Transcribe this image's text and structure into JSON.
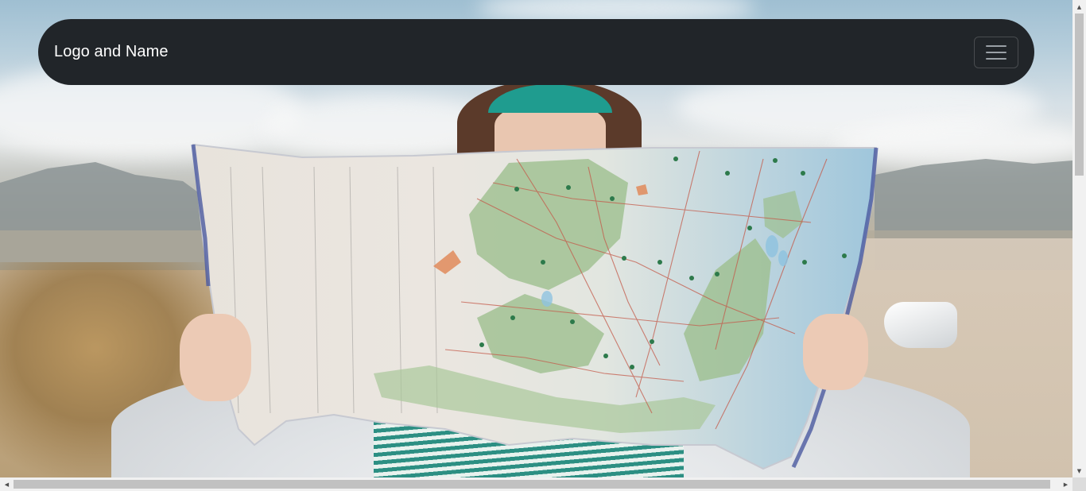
{
  "navbar": {
    "brand": "Logo and Name",
    "toggler_icon": "hamburger-menu-icon",
    "background_color": "#212529",
    "text_color": "#ffffff"
  },
  "hero": {
    "image_subject": "person holding a road map in front of a car in the desert"
  },
  "scrollbars": {
    "vertical": true,
    "horizontal": true
  }
}
